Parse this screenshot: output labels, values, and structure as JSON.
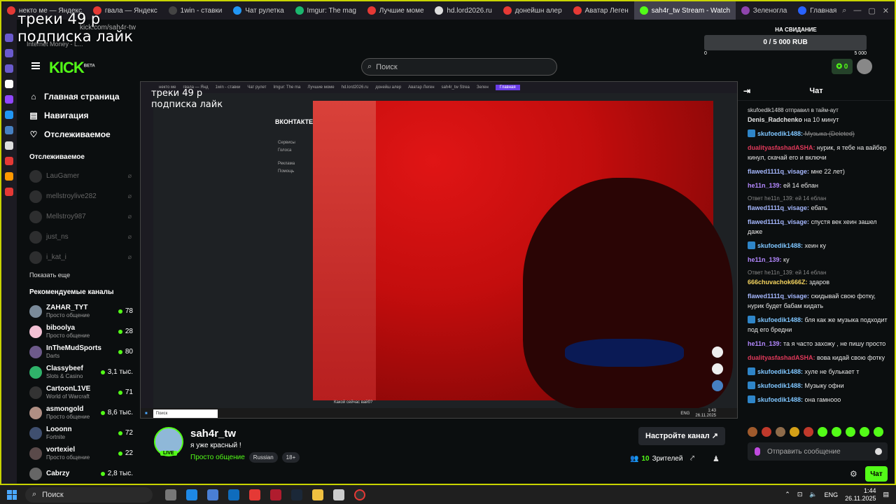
{
  "overlay": {
    "line1": "треки 49 р",
    "line2": "подписка лайк"
  },
  "browser": {
    "url": "kick.com/sah4r-tw",
    "subtitle": "Internet Money - L...",
    "tabs": [
      {
        "label": "некто ме — Яндекс",
        "color": "#e53935"
      },
      {
        "label": "гвала — Яндекс",
        "color": "#e53935"
      },
      {
        "label": "1win - ставки",
        "color": "#444"
      },
      {
        "label": "Чат рулетка",
        "color": "#2196f3"
      },
      {
        "label": "Imgur: The mag",
        "color": "#1bb76e"
      },
      {
        "label": "Лучшие моме",
        "color": "#e53935"
      },
      {
        "label": "hd.lord2026.ru",
        "color": "#ddd"
      },
      {
        "label": "донейшн алер",
        "color": "#e53935"
      },
      {
        "label": "Аватар Леген",
        "color": "#e53935"
      },
      {
        "label": "sah4r_tw Stream - Watch",
        "color": "#53fc18",
        "active": true
      },
      {
        "label": "Зеленогла",
        "color": "#8e44ad"
      },
      {
        "label": "Главная",
        "color": "#2962ff"
      }
    ]
  },
  "header": {
    "logo": "KICK",
    "logo_sup": "BETA",
    "search_placeholder": "Поиск"
  },
  "donation": {
    "title": "НА СВИДАНИЕ",
    "progress": "0 / 5 000 RUB",
    "min": "0",
    "max": "5 000",
    "progress_fraction": 0
  },
  "user": {
    "points": "0"
  },
  "sidebar": {
    "nav": [
      {
        "label": "Главная страница",
        "icon": "⌂"
      },
      {
        "label": "Навигация",
        "icon": "▤"
      },
      {
        "label": "Отслеживаемое",
        "icon": "♡"
      }
    ],
    "following_title": "Отслеживаемое",
    "following": [
      "LauGamer",
      "mellstroylive282",
      "Mellstroy987",
      "just_ns",
      "i_kat_i"
    ],
    "show_more": "Показать еще",
    "recommended_title": "Рекомендуемые каналы",
    "recommended": [
      {
        "name": "ZAHAR_TYT",
        "category": "Просто общение",
        "viewers": "78",
        "color": "#7a8a99"
      },
      {
        "name": "biboolya",
        "category": "Просто общение",
        "viewers": "28",
        "color": "#f3c1d4"
      },
      {
        "name": "InTheMudSports",
        "category": "Darts",
        "viewers": "80",
        "color": "#6d5a8a"
      },
      {
        "name": "Classybeef",
        "category": "Slots & Casino",
        "viewers": "3,1 тыс.",
        "color": "#2fb36a"
      },
      {
        "name": "CartoonL1VE",
        "category": "World of Warcraft",
        "viewers": "71",
        "color": "#333"
      },
      {
        "name": "asmongold",
        "category": "Просто общение",
        "viewers": "8,6 тыс.",
        "color": "#b08f84"
      },
      {
        "name": "Looonn",
        "category": "Fortnite",
        "viewers": "72",
        "color": "#3f4f6f"
      },
      {
        "name": "vortexiel",
        "category": "Просто общение",
        "viewers": "22",
        "color": "#5a4a4a"
      },
      {
        "name": "Cabrzy",
        "category": "",
        "viewers": "2,8 тыс.",
        "color": "#666"
      }
    ]
  },
  "video": {
    "inner_tabs": [
      "некто ме",
      "гвала — Янд",
      "1win - ставки",
      "Чат рулет",
      "Imgur: The ma",
      "Лучшие моме",
      "hd.lord2026.ru",
      "донейш алер",
      "Аватар Леген",
      "sah4r_tw Strea",
      "Зелен",
      "Главная"
    ],
    "vk_title": "ВКОНТАКТЕ",
    "vk_menu": [
      "Сервисы",
      "Голоса",
      "Реклама",
      "Помощь"
    ],
    "caption": "Какой сейчас вайб?",
    "task_search": "Поиск",
    "task_lang": "ENG",
    "task_time": "1:43",
    "task_date": "26.11.2025"
  },
  "channel": {
    "name": "sah4r_tw",
    "live": "LIVE",
    "title": "я уже красный !",
    "category": "Просто общение",
    "tags": [
      "Russian",
      "18+"
    ],
    "setup_button": "Настройте канал",
    "viewers_count": "10",
    "viewers_label": "Зрителей"
  },
  "chat": {
    "title": "Чат",
    "messages": [
      {
        "timeout": "skufoedik1488 отправил в тайм-аут",
        "user": "Denis_Radchenko",
        "text": " на 10 минут",
        "color": "#e6e6e6"
      },
      {
        "user": "skufoedik1488:",
        "text": " Музыка (Deleted)",
        "color": "#7fc6ff",
        "deleted": true,
        "badge": true
      },
      {
        "user": "dualityasfashadASHA:",
        "text": " нурик, я тебе на вайбер кинул, скачай его и включи",
        "color": "#e0395a"
      },
      {
        "user": "flawed1111q_visage:",
        "text": " мне 22 лет)",
        "color": "#a6b8ff"
      },
      {
        "user": "he11n_139:",
        "text": " ей 14 еблан",
        "color": "#b388ff"
      },
      {
        "reply": "Ответ he11n_139: ей 14 еблан",
        "user": "flawed1111q_visage:",
        "text": " ебать",
        "color": "#a6b8ff"
      },
      {
        "user": "flawed1111q_visage:",
        "text": " спустя век хеин зашел даже",
        "color": "#a6b8ff"
      },
      {
        "user": "skufoedik1488:",
        "text": " хеин ку",
        "color": "#7fc6ff",
        "badge": true
      },
      {
        "user": "he11n_139:",
        "text": " ку",
        "color": "#b388ff"
      },
      {
        "reply": "Ответ he11n_139: ей 14 еблан",
        "user": "666chuvachok666Z:",
        "text": " здаров",
        "color": "#f4d35e"
      },
      {
        "user": "flawed1111q_visage:",
        "text": " скидывай свою фотку, нурик будет бабам кидать",
        "color": "#a6b8ff"
      },
      {
        "user": "skufoedik1488:",
        "text": " бля как же музыка подходит под его бредни",
        "color": "#7fc6ff",
        "badge": true
      },
      {
        "user": "he11n_139:",
        "text": " та я часто захожу , не пишу просто",
        "color": "#b388ff"
      },
      {
        "user": "dualityasfashadASHA:",
        "text": " вова кидай свою фотку",
        "color": "#e0395a"
      },
      {
        "user": "skufoedik1488:",
        "text": " хуле не булькает т",
        "color": "#7fc6ff",
        "badge": true
      },
      {
        "user": "skufoedik1488:",
        "text": " Музыку офни",
        "color": "#7fc6ff",
        "badge": true
      },
      {
        "user": "skufoedik1488:",
        "text": " она гамнооо",
        "color": "#7fc6ff",
        "badge": true
      }
    ],
    "input_placeholder": "Отправить сообщение",
    "send_label": "Чат"
  },
  "taskbar": {
    "search": "Поиск",
    "lang": "ENG",
    "time": "1:44",
    "date": "26.11.2025"
  }
}
